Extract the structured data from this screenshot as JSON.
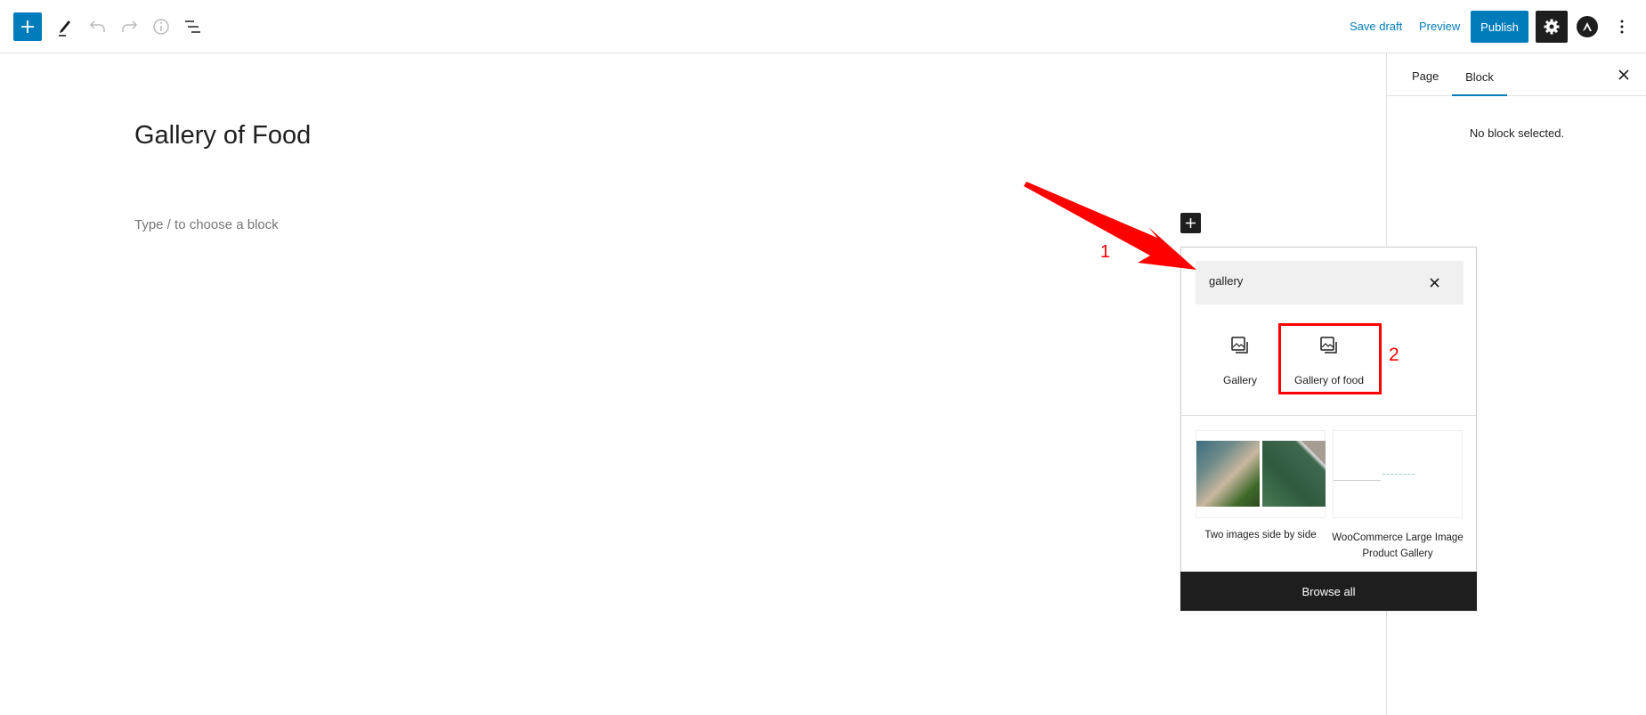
{
  "toolbar": {
    "add_block_icon": "plus-icon",
    "tools_icon": "pencil-icon",
    "undo_icon": "undo-icon",
    "redo_icon": "redo-icon",
    "details_icon": "info-icon",
    "outline_icon": "list-view-icon",
    "save_draft": "Save draft",
    "preview": "Preview",
    "publish": "Publish",
    "accent_color": "#007cba"
  },
  "editor": {
    "title": "Gallery of Food",
    "placeholder": "Type / to choose a block"
  },
  "sidebar": {
    "tabs": [
      {
        "label": "Page"
      },
      {
        "label": "Block",
        "active": true
      }
    ],
    "empty_message": "No block selected."
  },
  "inserter": {
    "search_value": "gallery",
    "blocks": [
      {
        "label": "Gallery"
      },
      {
        "label": "Gallery of food"
      }
    ],
    "patterns": [
      {
        "label": "Two images side by side"
      },
      {
        "label": "WooCommerce Large Image Product Gallery"
      }
    ],
    "browse_all": "Browse all"
  },
  "annotations": {
    "step1": "1",
    "step2": "2",
    "color": "#ff0000"
  }
}
